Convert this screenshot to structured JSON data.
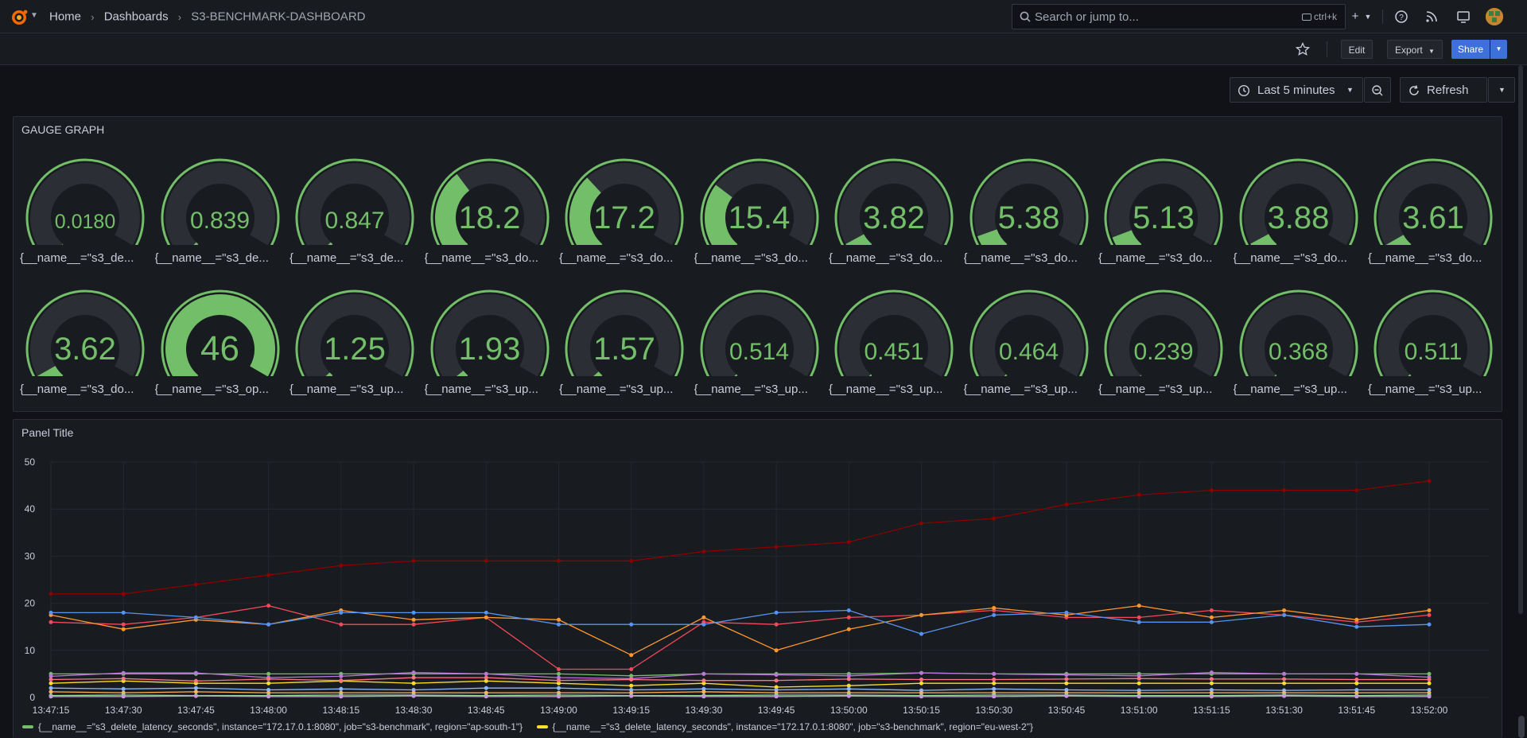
{
  "topbar": {
    "breadcrumbs": [
      "Home",
      "Dashboards",
      "S3-BENCHMARK-DASHBOARD"
    ],
    "search_placeholder": "Search or jump to...",
    "search_shortcut": "ctrl+k",
    "icons": [
      "plus-icon",
      "help-icon",
      "rss-icon",
      "monitor-icon",
      "avatar"
    ]
  },
  "toolbar": {
    "edit_label": "Edit",
    "export_label": "Export",
    "share_label": "Share"
  },
  "timepicker": {
    "range_label": "Last 5 minutes",
    "refresh_label": "Refresh"
  },
  "gauge_panel": {
    "title": "GAUGE GRAPH",
    "gauges": [
      {
        "value": "0.0180",
        "label": "{__name__=\"s3_de...",
        "fraction": 0.0004
      },
      {
        "value": "0.839",
        "label": "{__name__=\"s3_de...",
        "fraction": 0.018
      },
      {
        "value": "0.847",
        "label": "{__name__=\"s3_de...",
        "fraction": 0.018
      },
      {
        "value": "18.2",
        "label": "{__name__=\"s3_do...",
        "fraction": 0.396
      },
      {
        "value": "17.2",
        "label": "{__name__=\"s3_do...",
        "fraction": 0.374
      },
      {
        "value": "15.4",
        "label": "{__name__=\"s3_do...",
        "fraction": 0.335
      },
      {
        "value": "3.82",
        "label": "{__name__=\"s3_do...",
        "fraction": 0.083
      },
      {
        "value": "5.38",
        "label": "{__name__=\"s3_do...",
        "fraction": 0.117
      },
      {
        "value": "5.13",
        "label": "{__name__=\"s3_do...",
        "fraction": 0.112
      },
      {
        "value": "3.88",
        "label": "{__name__=\"s3_do...",
        "fraction": 0.084
      },
      {
        "value": "3.61",
        "label": "{__name__=\"s3_do...",
        "fraction": 0.078
      },
      {
        "value": "3.62",
        "label": "{__name__=\"s3_do...",
        "fraction": 0.079
      },
      {
        "value": "46",
        "label": "{__name__=\"s3_op...",
        "fraction": 1.0
      },
      {
        "value": "1.25",
        "label": "{__name__=\"s3_up...",
        "fraction": 0.027
      },
      {
        "value": "1.93",
        "label": "{__name__=\"s3_up...",
        "fraction": 0.042
      },
      {
        "value": "1.57",
        "label": "{__name__=\"s3_up...",
        "fraction": 0.034
      },
      {
        "value": "0.514",
        "label": "{__name__=\"s3_up...",
        "fraction": 0.011
      },
      {
        "value": "0.451",
        "label": "{__name__=\"s3_up...",
        "fraction": 0.01
      },
      {
        "value": "0.464",
        "label": "{__name__=\"s3_up...",
        "fraction": 0.01
      },
      {
        "value": "0.239",
        "label": "{__name__=\"s3_up...",
        "fraction": 0.005
      },
      {
        "value": "0.368",
        "label": "{__name__=\"s3_up...",
        "fraction": 0.008
      },
      {
        "value": "0.511",
        "label": "{__name__=\"s3_up...",
        "fraction": 0.011
      }
    ]
  },
  "time_panel": {
    "title": "Panel Title"
  },
  "chart_data": {
    "type": "line",
    "title": "Panel Title",
    "x": [
      "13:47:15",
      "13:47:30",
      "13:47:45",
      "13:48:00",
      "13:48:15",
      "13:48:30",
      "13:48:45",
      "13:49:00",
      "13:49:15",
      "13:49:30",
      "13:49:45",
      "13:50:00",
      "13:50:15",
      "13:50:30",
      "13:50:45",
      "13:51:00",
      "13:51:15",
      "13:51:30",
      "13:51:45",
      "13:52:00"
    ],
    "ylim": [
      0,
      50
    ],
    "yticks": [
      0,
      10,
      20,
      30,
      40,
      50
    ],
    "grid": true,
    "legend_position": "bottom",
    "series": [
      {
        "name": "{__name__=\"s3_delete_latency_seconds\", instance=\"172.17.0.1:8080\", job=\"s3-benchmark\", region=\"ap-south-1\"}",
        "color": "#73bf69",
        "values": [
          5,
          5,
          5,
          5,
          5,
          5,
          5,
          5,
          4.6,
          5,
          5,
          5,
          5.2,
          5,
          5,
          5,
          5,
          5,
          5,
          5
        ]
      },
      {
        "name": "{__name__=\"s3_delete_latency_seconds\", instance=\"172.17.0.1:8080\", job=\"s3-benchmark\", region=\"eu-west-2\"}",
        "color": "#fade2a",
        "values": [
          3,
          3.5,
          3,
          3,
          3.5,
          3,
          3.5,
          3,
          2.5,
          3,
          2.2,
          2.5,
          3,
          3,
          3,
          3,
          3,
          3,
          3,
          3
        ]
      },
      {
        "color": "#8b0000",
        "values": [
          22,
          22,
          24,
          26,
          28,
          29,
          29,
          29,
          29,
          31,
          32,
          33,
          37,
          38,
          41,
          43,
          44,
          44,
          44,
          46
        ]
      },
      {
        "color": "#f2495c",
        "values": [
          16,
          15.5,
          17,
          19.5,
          15.5,
          15.5,
          17,
          6,
          6,
          16,
          15.5,
          17,
          17.5,
          18.5,
          17,
          17,
          18.5,
          17.5,
          16,
          17.5
        ]
      },
      {
        "color": "#ff9830",
        "values": [
          17.5,
          14.5,
          16.5,
          15.5,
          18.5,
          16.5,
          17,
          16.5,
          9,
          17,
          10,
          14.5,
          17.5,
          19,
          17.5,
          19.5,
          17,
          18.5,
          16.5,
          18.5
        ]
      },
      {
        "color": "#5794f2",
        "values": [
          18,
          18,
          17,
          15.5,
          18,
          18,
          18,
          15.5,
          15.5,
          15.5,
          18,
          18.5,
          13.5,
          17.5,
          18,
          16,
          16,
          17.5,
          15,
          15.5
        ]
      },
      {
        "color": "#b877d9",
        "values": [
          4.5,
          5.2,
          5.2,
          4.2,
          4.5,
          5.3,
          5,
          4.2,
          4,
          5,
          4.8,
          4.6,
          5.2,
          5,
          4.8,
          4.6,
          5.3,
          5,
          5,
          4.3
        ]
      },
      {
        "color": "#ff7383",
        "values": [
          3.8,
          4,
          3.5,
          3.9,
          3.6,
          4.2,
          4.2,
          3.6,
          3.8,
          3.6,
          3.6,
          3.9,
          3.8,
          3.8,
          3.9,
          4,
          3.9,
          3.9,
          3.8,
          3.8
        ]
      },
      {
        "color": "#8ab8ff",
        "values": [
          2,
          1.8,
          2,
          1.6,
          1.8,
          1.6,
          2,
          2,
          1.6,
          1.8,
          1.6,
          1.8,
          1.5,
          1.8,
          1.6,
          1.5,
          1.6,
          1.5,
          1.6,
          1.6
        ]
      },
      {
        "color": "#ffb357",
        "values": [
          1.2,
          1,
          1.2,
          1,
          1,
          1,
          1,
          1,
          1,
          1.2,
          1,
          1,
          1,
          1,
          1,
          1,
          1,
          1,
          1,
          1
        ]
      },
      {
        "color": "#96d98d",
        "values": [
          0.4,
          0.5,
          0.4,
          0.4,
          0.5,
          0.5,
          0.4,
          0.5,
          0.4,
          0.4,
          0.5,
          0.5,
          0.4,
          0.5,
          0.5,
          0.4,
          0.4,
          0.5,
          0.4,
          0.5
        ]
      },
      {
        "color": "#ca95e5",
        "values": [
          0.2,
          0.2,
          0.3,
          0.2,
          0.2,
          0.3,
          0.2,
          0.2,
          0.3,
          0.2,
          0.2,
          0.3,
          0.2,
          0.2,
          0.3,
          0.2,
          0.2,
          0.3,
          0.2,
          0.2
        ]
      }
    ]
  }
}
